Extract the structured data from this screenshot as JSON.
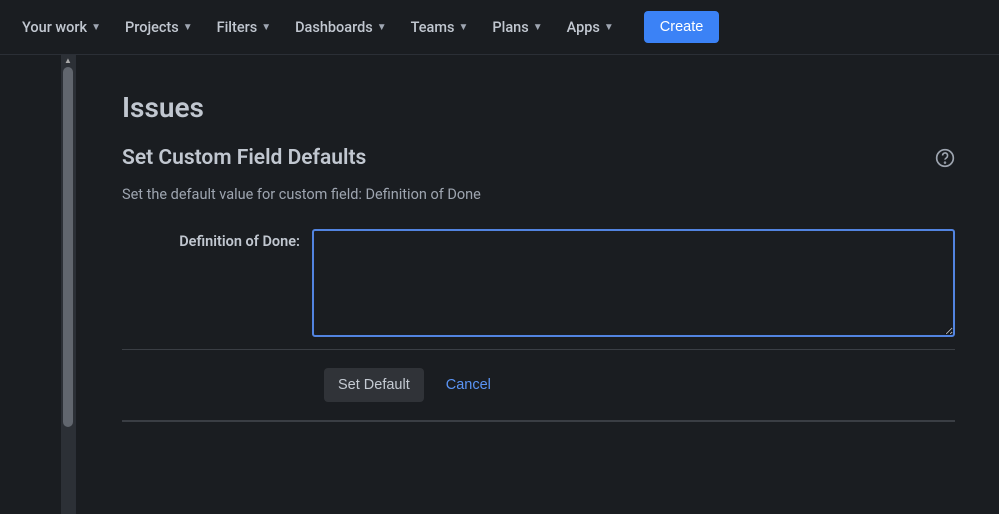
{
  "nav": {
    "items": [
      {
        "label": "Your work"
      },
      {
        "label": "Projects"
      },
      {
        "label": "Filters"
      },
      {
        "label": "Dashboards"
      },
      {
        "label": "Teams"
      },
      {
        "label": "Plans"
      },
      {
        "label": "Apps"
      }
    ],
    "create": "Create"
  },
  "page": {
    "title": "Issues",
    "section_title": "Set Custom Field Defaults",
    "description": "Set the default value for custom field: Definition of Done",
    "field_label": "Definition of Done:",
    "field_value": "",
    "set_default": "Set Default",
    "cancel": "Cancel"
  }
}
